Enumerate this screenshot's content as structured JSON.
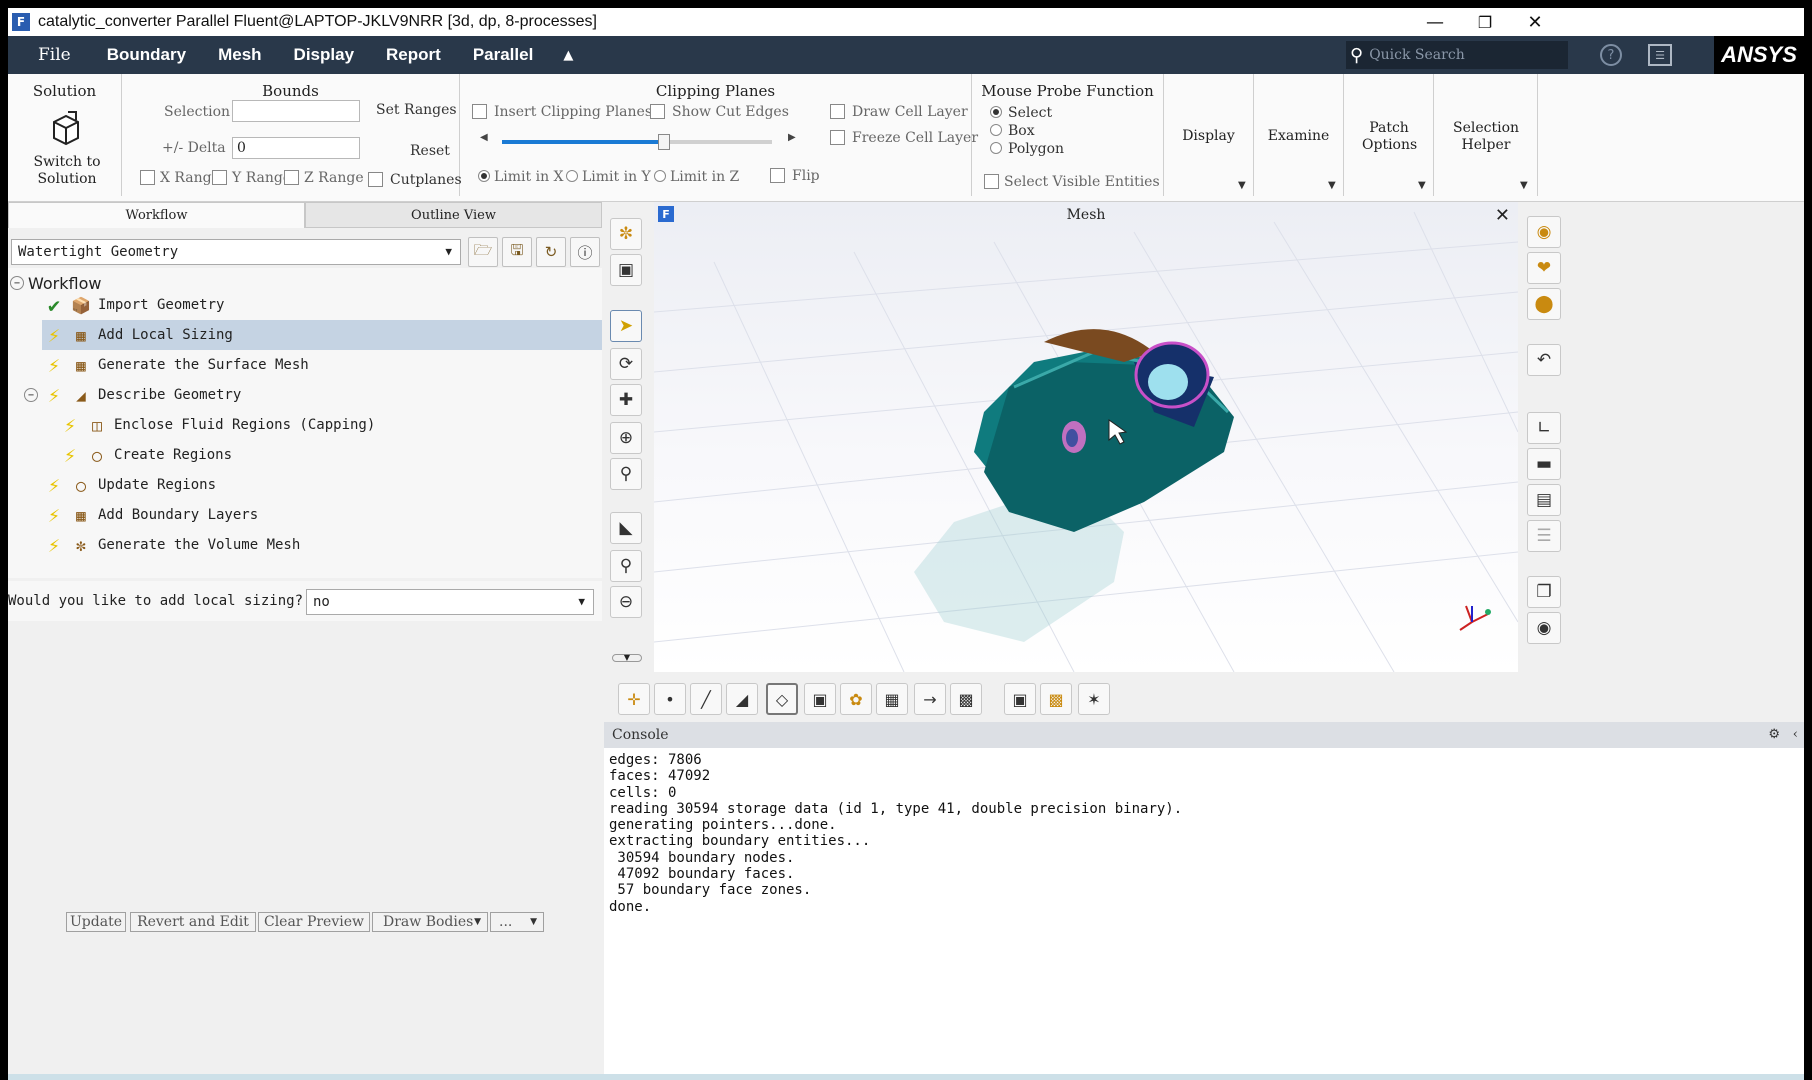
{
  "window": {
    "app_icon": "F",
    "title": "catalytic_converter Parallel Fluent@LAPTOP-JKLV9NRR  [3d, dp, 8-processes]",
    "minimize": "—",
    "restore": "❐",
    "close": "✕"
  },
  "menubar": {
    "items": [
      "File",
      "Boundary",
      "Mesh",
      "Display",
      "Report",
      "Parallel"
    ],
    "collapse": "▲",
    "search_placeholder": "Quick Search",
    "brand": "ANSYS"
  },
  "ribbon": {
    "solution": {
      "title": "Solution",
      "button_label": "Switch to Solution"
    },
    "bounds": {
      "title": "Bounds",
      "selection_label": "Selection",
      "selection_value": "",
      "set_ranges": "Set Ranges",
      "delta_label": "+/- Delta",
      "delta_value": "0",
      "reset": "Reset",
      "x_range": "X Range",
      "y_range": "Y Range",
      "z_range": "Z Range",
      "cutplanes": "Cutplanes"
    },
    "clipping": {
      "title": "Clipping Planes",
      "insert": "Insert Clipping Planes",
      "show_cut_edges": "Show Cut Edges",
      "draw_cell_layer": "Draw Cell Layer",
      "freeze_cell_layer": "Freeze Cell Layer",
      "limit_x": "Limit in X",
      "limit_y": "Limit in Y",
      "limit_z": "Limit in Z",
      "flip": "Flip",
      "slider_value": 0.6,
      "selected_limit": "Limit in X"
    },
    "mouse_probe": {
      "title": "Mouse Probe Function",
      "options": [
        "Select",
        "Box",
        "Polygon"
      ],
      "selected": "Select",
      "visible": "Select Visible Entities"
    },
    "display": "Display",
    "examine": "Examine",
    "patch_options": "Patch Options",
    "selection_helper": "Selection Helper"
  },
  "left": {
    "tabs": [
      "Workflow",
      "Outline View"
    ],
    "active_tab": "Workflow",
    "workflow_select": "Watertight Geometry",
    "tree_root": "Workflow",
    "tree": [
      {
        "label": "Import Geometry",
        "status": "done",
        "indent": 0
      },
      {
        "label": "Add Local Sizing",
        "status": "pending",
        "indent": 0,
        "selected": true
      },
      {
        "label": "Generate the Surface Mesh",
        "status": "pending",
        "indent": 0
      },
      {
        "label": "Describe Geometry",
        "status": "pending",
        "indent": 0,
        "expandable": true
      },
      {
        "label": "Enclose Fluid Regions (Capping)",
        "status": "pending",
        "indent": 1
      },
      {
        "label": "Create Regions",
        "status": "pending",
        "indent": 1
      },
      {
        "label": "Update Regions",
        "status": "pending",
        "indent": 0
      },
      {
        "label": "Add Boundary Layers",
        "status": "pending",
        "indent": 0
      },
      {
        "label": "Generate the Volume Mesh",
        "status": "pending",
        "indent": 0
      }
    ],
    "question": "Would you like to add local sizing?",
    "answer": "no",
    "buttons": {
      "update": "Update",
      "revert": "Revert and Edit",
      "clear": "Clear Preview",
      "draw": "Draw Bodies",
      "more": "..."
    }
  },
  "graphics": {
    "title": "Mesh",
    "icon": "F",
    "close": "✕"
  },
  "console": {
    "title": "Console",
    "lines": [
      "edges: 7806",
      "faces: 47092",
      "cells: 0",
      "reading 30594 storage data (id 1, type 41, double precision binary).",
      "generating pointers...done.",
      "extracting boundary entities...",
      " 30594 boundary nodes.",
      " 47092 boundary faces.",
      " 57 boundary face zones.",
      "done."
    ]
  },
  "colors": {
    "menubar": "#29384a",
    "selected_row": "#c5d3e3",
    "teal_body": "#0e6f72",
    "pipe_blue": "#15306a",
    "magenta": "#c850c8"
  }
}
